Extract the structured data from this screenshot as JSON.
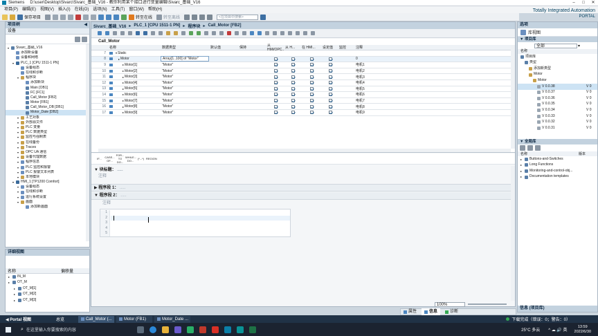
{
  "window": {
    "app": "Siemens",
    "path": "D:\\user\\Desktop\\Sivarc\\Sivarc_基础_V16 - 教你利用某个接口进行变量编辑\\Sivarc_基础_V16"
  },
  "menu": [
    "项目(P)",
    "编辑(E)",
    "视图(V)",
    "插入(I)",
    "在线(O)",
    "选项(N)",
    "工具(T)",
    "窗口(W)",
    "帮助(H)"
  ],
  "toolbar": {
    "save_label": "保存项目",
    "online_label": "转至在线",
    "offline_label": "转至离线",
    "search_placeholder": "<在项目中搜索>"
  },
  "brand": {
    "line1": "Totally Integrated Automation",
    "line2": "PORTAL"
  },
  "project_tree": {
    "header": "项目树",
    "devices_tab": "设备",
    "items": [
      {
        "label": "Sivarc_基础_V16",
        "level": 0,
        "color": "#5a7fa8"
      },
      {
        "label": "添加新设备",
        "level": 1,
        "color": "#6b8fbf"
      },
      {
        "label": "设备和网络",
        "level": 1,
        "color": "#6b8fbf"
      },
      {
        "label": "PLC_1 [CPU 1511-1 PN]",
        "level": 1,
        "color": "#3a6a9a"
      },
      {
        "label": "设备组态",
        "level": 2,
        "color": "#6b8fbf"
      },
      {
        "label": "在线和诊断",
        "level": 2,
        "color": "#6b8fbf"
      },
      {
        "label": "程序块",
        "level": 2,
        "color": "#c8a04a"
      },
      {
        "label": "添加新块",
        "level": 3,
        "color": "#6b8fbf"
      },
      {
        "label": "Main [OB1]",
        "level": 3,
        "color": "#5a7fa8"
      },
      {
        "label": "FC [FC1]",
        "level": 3,
        "color": "#5a7fa8"
      },
      {
        "label": "Call_Motor [FB2]",
        "level": 3,
        "color": "#5a7fa8"
      },
      {
        "label": "Motor [FB1]",
        "level": 3,
        "color": "#5a7fa8"
      },
      {
        "label": "Call_Motor_DB [DB1]",
        "level": 3,
        "color": "#5a7fa8"
      },
      {
        "label": "Motor_Date [DB2]",
        "level": 3,
        "color": "#5a7fa8"
      },
      {
        "label": "工艺对象",
        "level": 2,
        "color": "#c8a04a"
      },
      {
        "label": "外部源文件",
        "level": 2,
        "color": "#c8a04a"
      },
      {
        "label": "PLC 变量",
        "level": 2,
        "color": "#c8a04a"
      },
      {
        "label": "PLC 数据类型",
        "level": 2,
        "color": "#c8a04a"
      },
      {
        "label": "监控与强制表",
        "level": 2,
        "color": "#c8a04a"
      },
      {
        "label": "在线备份",
        "level": 2,
        "color": "#c8a04a"
      },
      {
        "label": "Traces",
        "level": 2,
        "color": "#c8a04a"
      },
      {
        "label": "OPC UA 通信",
        "level": 2,
        "color": "#c8a04a"
      },
      {
        "label": "设备代理数据",
        "level": 2,
        "color": "#c8a04a"
      },
      {
        "label": "程序信息",
        "level": 2,
        "color": "#6b8fbf"
      },
      {
        "label": "PLC 监控和报警",
        "level": 2,
        "color": "#6b8fbf"
      },
      {
        "label": "PLC 报警文本列表",
        "level": 2,
        "color": "#6b8fbf"
      },
      {
        "label": "本地模块",
        "level": 2,
        "color": "#c8a04a"
      },
      {
        "label": "HMI_1 [TP1200 Comfort]",
        "level": 1,
        "color": "#3a6a9a"
      },
      {
        "label": "设备组态",
        "level": 2,
        "color": "#6b8fbf"
      },
      {
        "label": "在线和诊断",
        "level": 2,
        "color": "#6b8fbf"
      },
      {
        "label": "运行系统设置",
        "level": 2,
        "color": "#6b8fbf"
      },
      {
        "label": "画面",
        "level": 2,
        "color": "#c8a04a"
      },
      {
        "label": "添加新画面",
        "level": 3,
        "color": "#6b8fbf"
      }
    ]
  },
  "details_view": {
    "header": "详细视图",
    "col_name": "名称",
    "col_offset": "偏移量",
    "items": [
      {
        "label": "IN_M",
        "level": 0
      },
      {
        "label": "OT_M",
        "level": 0
      },
      {
        "label": "OT_M[1]",
        "level": 1
      },
      {
        "label": "OT_M[2]",
        "level": 1
      },
      {
        "label": "OT_M[3]",
        "level": 1
      }
    ]
  },
  "breadcrumb": [
    "Sivarc_基础_V16",
    "PLC_1 [CPU 1511-1 PN]",
    "程序块",
    "Call_Motor [FB2]"
  ],
  "block_title": "Call_Motor",
  "interface_table": {
    "headers": [
      "名称",
      "数据类型",
      "默认值",
      "保持",
      "从 HMI/OPC...",
      "从 H...",
      "在 HMI...",
      "设定值",
      "监控",
      "注释"
    ],
    "rows": [
      {
        "num": "7",
        "name": "Static",
        "type": "",
        "comment": "",
        "section": true
      },
      {
        "num": "8",
        "name": "Motor",
        "type": "Array[1..100] of \"Motor\"",
        "comment": "0",
        "section": false
      },
      {
        "num": "9",
        "name": "Motor[1]",
        "type": "\"Motor\"",
        "comment": "电机1",
        "section": false
      },
      {
        "num": "10",
        "name": "Motor[2]",
        "type": "\"Motor\"",
        "comment": "电机2",
        "section": false
      },
      {
        "num": "11",
        "name": "Motor[3]",
        "type": "\"Motor\"",
        "comment": "电机3",
        "section": false
      },
      {
        "num": "12",
        "name": "Motor[4]",
        "type": "\"Motor\"",
        "comment": "电机4",
        "section": false
      },
      {
        "num": "13",
        "name": "Motor[5]",
        "type": "\"Motor\"",
        "comment": "电机5",
        "section": false
      },
      {
        "num": "14",
        "name": "Motor[6]",
        "type": "\"Motor\"",
        "comment": "电机6",
        "section": false
      },
      {
        "num": "15",
        "name": "Motor[7]",
        "type": "\"Motor\"",
        "comment": "电机7",
        "section": false
      },
      {
        "num": "16",
        "name": "Motor[8]",
        "type": "\"Motor\"",
        "comment": "电机8",
        "section": false
      },
      {
        "num": "17",
        "name": "Motor[9]",
        "type": "\"Motor\"",
        "comment": "电机9",
        "section": false
      }
    ]
  },
  "scl_toolbar": [
    "IF...",
    "CASE... OF...",
    "FOR... TO DO...",
    "WHILE... DO...",
    "(*...*)",
    "REGION"
  ],
  "editor": {
    "block_title_label": "块标题：",
    "comment_label": "注释",
    "network1_label": "程序段 1：",
    "network1_dots": ".....",
    "network2_label": "程序段 2：",
    "network2_dots": ".....",
    "network2_comment": "注释",
    "line_numbers": [
      "1",
      "2",
      "3",
      "4",
      "5"
    ],
    "zoom": "100%"
  },
  "inspector_tabs": [
    "属性",
    "信息",
    "诊断"
  ],
  "right_panel": {
    "options_label": "选项",
    "library_view": "库视图",
    "project_library": "项目库",
    "filter_value": "全部",
    "col_name": "名称",
    "lib_items": [
      {
        "label": "项目库",
        "level": 0
      },
      {
        "label": "类型",
        "level": 1
      },
      {
        "label": "添加新类型",
        "level": 2
      },
      {
        "label": "Motor",
        "level": 2
      },
      {
        "label": "Motor",
        "level": 3
      },
      {
        "label": "V 0.0.38",
        "level": 4,
        "ver": "V 0",
        "sel": true
      },
      {
        "label": "V 0.0.37",
        "level": 4,
        "ver": "V 0"
      },
      {
        "label": "V 0.0.36",
        "level": 4,
        "ver": "V 0"
      },
      {
        "label": "V 0.0.35",
        "level": 4,
        "ver": "V 0"
      },
      {
        "label": "V 0.0.34",
        "level": 4,
        "ver": "V 0"
      },
      {
        "label": "V 0.0.33",
        "level": 4,
        "ver": "V 0"
      },
      {
        "label": "V 0.0.32",
        "level": 4,
        "ver": "V 0"
      },
      {
        "label": "V 0.0.31",
        "level": 4,
        "ver": "V 0"
      }
    ],
    "global_library": "全局库",
    "global_col_version": "版本",
    "global_items": [
      "Buttons-and-Switches",
      "Long Functions",
      "Monitoring-and-control-obj...",
      "Documentation templates"
    ],
    "info_header": "信息 (项目库)"
  },
  "statusbar": {
    "portal_view": "Portal 视图",
    "overview": "总览",
    "tabs": [
      "Call_Motor (...",
      "Motor (FB1)",
      "Motor_Date ..."
    ],
    "message": "下载完成（错误：0；警告：0）"
  },
  "taskbar": {
    "search_placeholder": "在这里输入你要搜索的内容",
    "weather": "25°C 多云",
    "time": "13:59",
    "date": "2022/6/30"
  },
  "colors": {
    "accent": "#0b6aa6",
    "panel_header": "#c3d2df",
    "selection": "#cde3f4",
    "taskbar": "#1b2330"
  }
}
